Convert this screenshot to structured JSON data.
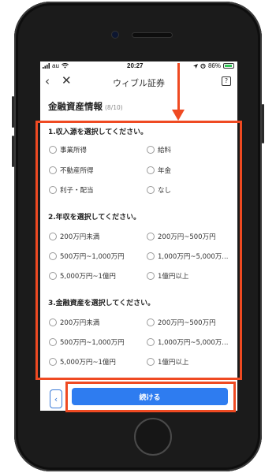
{
  "status_bar": {
    "carrier": "au",
    "time": "20:27",
    "battery_pct": "86%",
    "battery_level": 0.86
  },
  "nav": {
    "back_glyph": "‹",
    "close_glyph": "✕",
    "title": "ウィブル証券",
    "help_glyph": "?"
  },
  "page": {
    "title": "金融資産情報",
    "step": "(8/10)"
  },
  "q1": {
    "label": "1.収入源を選択してください。",
    "options": [
      "事業所得",
      "給料",
      "不動産所得",
      "年金",
      "利子・配当",
      "なし"
    ]
  },
  "q2": {
    "label": "2.年収を選択してください。",
    "options": [
      "200万円未満",
      "200万円~500万円",
      "500万円~1,000万円",
      "1,000万円~5,000万...",
      "5,000万円~1億円",
      "1億円以上"
    ]
  },
  "q3": {
    "label": "3.金融資産を選択してください。",
    "options": [
      "200万円未満",
      "200万円~500万円",
      "500万円~1,000万円",
      "1,000万円~5,000万...",
      "5,000万円~1億円",
      "1億円以上"
    ]
  },
  "buttons": {
    "back": "‹",
    "continue": "続ける"
  },
  "colors": {
    "accent": "#2e7cf0",
    "annotation": "#ef4a22",
    "battery": "#35c759"
  }
}
